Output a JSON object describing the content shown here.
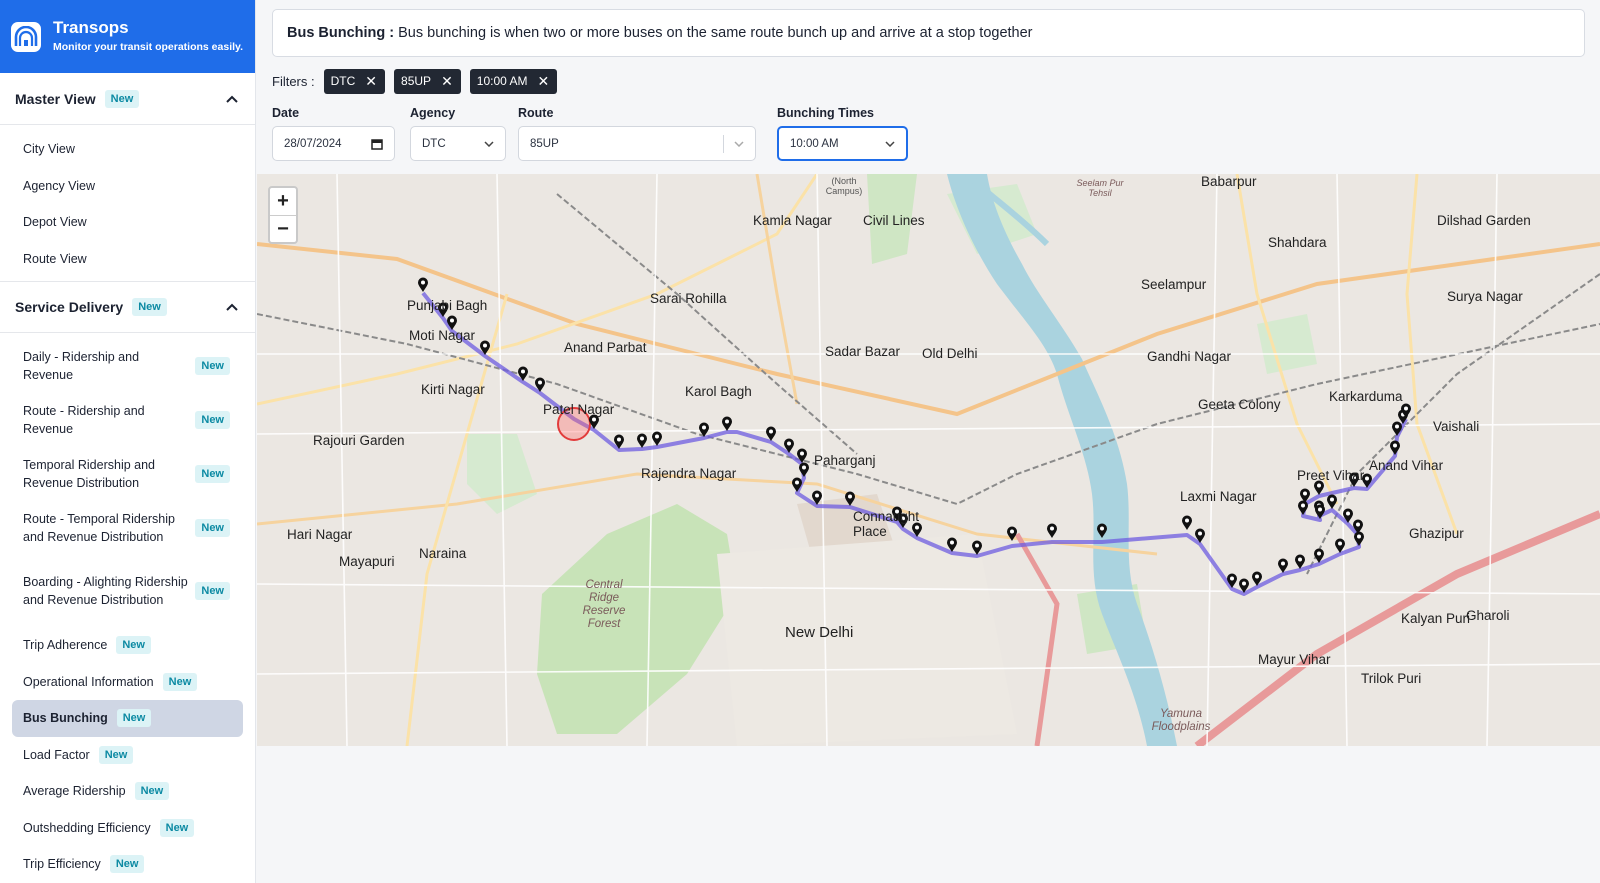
{
  "brand": {
    "title": "Transops",
    "subtitle": "Monitor your transit operations easily."
  },
  "sidebar": {
    "master": {
      "label": "Master View",
      "badge": "New",
      "items": [
        "City View",
        "Agency View",
        "Depot View",
        "Route View"
      ]
    },
    "service": {
      "label": "Service Delivery",
      "badge": "New",
      "items": [
        {
          "label": "Daily - Ridership and Revenue",
          "badge": "New"
        },
        {
          "label": "Route - Ridership and Revenue",
          "badge": "New"
        },
        {
          "label": "Temporal Ridership and Revenue Distribution",
          "badge": "New"
        },
        {
          "label": "Route - Temporal Ridership and Revenue Distribution",
          "badge": "New"
        },
        {
          "label": "Boarding - Alighting Ridership and Revenue Distribution",
          "badge": "New"
        },
        {
          "label": "Trip Adherence",
          "badge": "New"
        },
        {
          "label": "Operational Information",
          "badge": "New"
        },
        {
          "label": "Bus Bunching",
          "badge": "New"
        },
        {
          "label": "Load Factor",
          "badge": "New"
        },
        {
          "label": "Average Ridership",
          "badge": "New"
        },
        {
          "label": "Outshedding Efficiency",
          "badge": "New"
        },
        {
          "label": "Trip Efficiency",
          "badge": "New"
        }
      ]
    }
  },
  "info": {
    "title": "Bus Bunching :",
    "text": "Bus bunching is when two or more buses on the same route bunch up and arrive at a stop together"
  },
  "filters": {
    "label": "Filters :",
    "chips": [
      "DTC",
      "85UP",
      "10:00 AM"
    ]
  },
  "form": {
    "date": {
      "label": "Date",
      "value": "28/07/2024"
    },
    "agency": {
      "label": "Agency",
      "value": "DTC"
    },
    "route": {
      "label": "Route",
      "value": "85UP"
    },
    "times": {
      "label": "Bunching Times",
      "value": "10:00 AM"
    }
  },
  "map": {
    "zoom_in": "+",
    "zoom_out": "−",
    "labels": {
      "punjabi_bagh": "Punjabi Bagh",
      "moti_nagar": "Moti Nagar",
      "kirti_nagar": "Kirti Nagar",
      "rajouri_garden": "Rajouri Garden",
      "hari_nagar": "Hari Nagar",
      "mayapuri": "Mayapuri",
      "naraina": "Naraina",
      "anand_parbat": "Anand Parbat",
      "patel_nagar": "Patel Nagar",
      "rajendra_nagar": "Rajendra Nagar",
      "karol_bagh": "Karol Bagh",
      "paharganj": "Paharganj",
      "connaught_place": "Connaught Place",
      "new_delhi": "New Delhi",
      "sarai_rohilla": "Sarai Rohilla",
      "kamla_nagar": "Kamla Nagar",
      "civil_lines": "Civil Lines",
      "sadar_bazar": "Sadar Bazar",
      "old_delhi": "Old Delhi",
      "shahdara": "Shahdara",
      "babarpur": "Babarpur",
      "seelampur": "Seelampur",
      "gandhi_nagar": "Gandhi Nagar",
      "geeta_colony": "Geeta Colony",
      "laxmi_nagar": "Laxmi Nagar",
      "karkarduma": "Karkarduma",
      "preet_vihar": "Preet Vihar",
      "anand_vihar": "Anand Vihar",
      "vaishali": "Vaishali",
      "dilshad_garden": "Dilshad Garden",
      "surya_nagar": "Surya Nagar",
      "ghazipur": "Ghazipur",
      "kalyan_puri": "Kalyan Puri",
      "mayur_vihar": "Mayur Vihar",
      "trilok_puri": "Trilok Puri",
      "gharoli": "Gharoli",
      "central_ridge": "Central Ridge Reserve Forest",
      "yamuna_floodplains": "Yamuna Floodplains",
      "seelam_pur_tehsil": "Seelam Pur Tehsil",
      "north_campus": "(North Campus)"
    }
  }
}
